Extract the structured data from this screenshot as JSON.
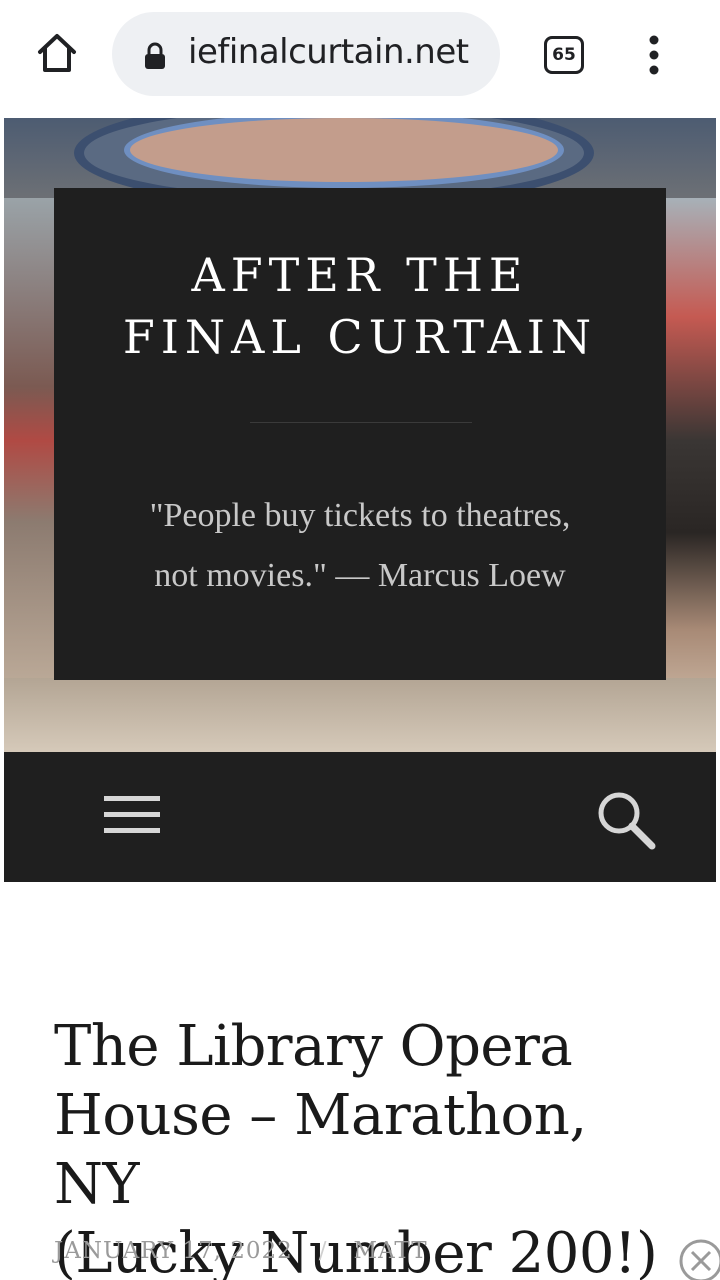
{
  "browser": {
    "url": "ɪefinalcurtain.net",
    "url_display": "iefinalcurtain.net",
    "tab_count": "65"
  },
  "site": {
    "title_line1": "AFTER THE",
    "title_line2": "FINAL CURTAIN",
    "tagline_line1": "\"People buy tickets to theatres,",
    "tagline_line2": "not movies.\" — Marcus Loew"
  },
  "post": {
    "title_line1": "The Library Opera",
    "title_line2": "House – Marathon, NY",
    "title_line3": "(Lucky Number 200!)",
    "date": "JANUARY 17, 2022",
    "separator": "/",
    "author": "MATT"
  },
  "icons": {
    "home": "home-icon",
    "lock": "lock-icon",
    "tabs": "tab-switcher-icon",
    "overflow": "more-vertical-icon",
    "menu": "hamburger-menu-icon",
    "search": "search-icon",
    "close": "close-icon"
  },
  "colors": {
    "header_bg": "#1f1f1f",
    "url_pill_bg": "#eef0f3",
    "meta_text": "#9a9a9a"
  }
}
